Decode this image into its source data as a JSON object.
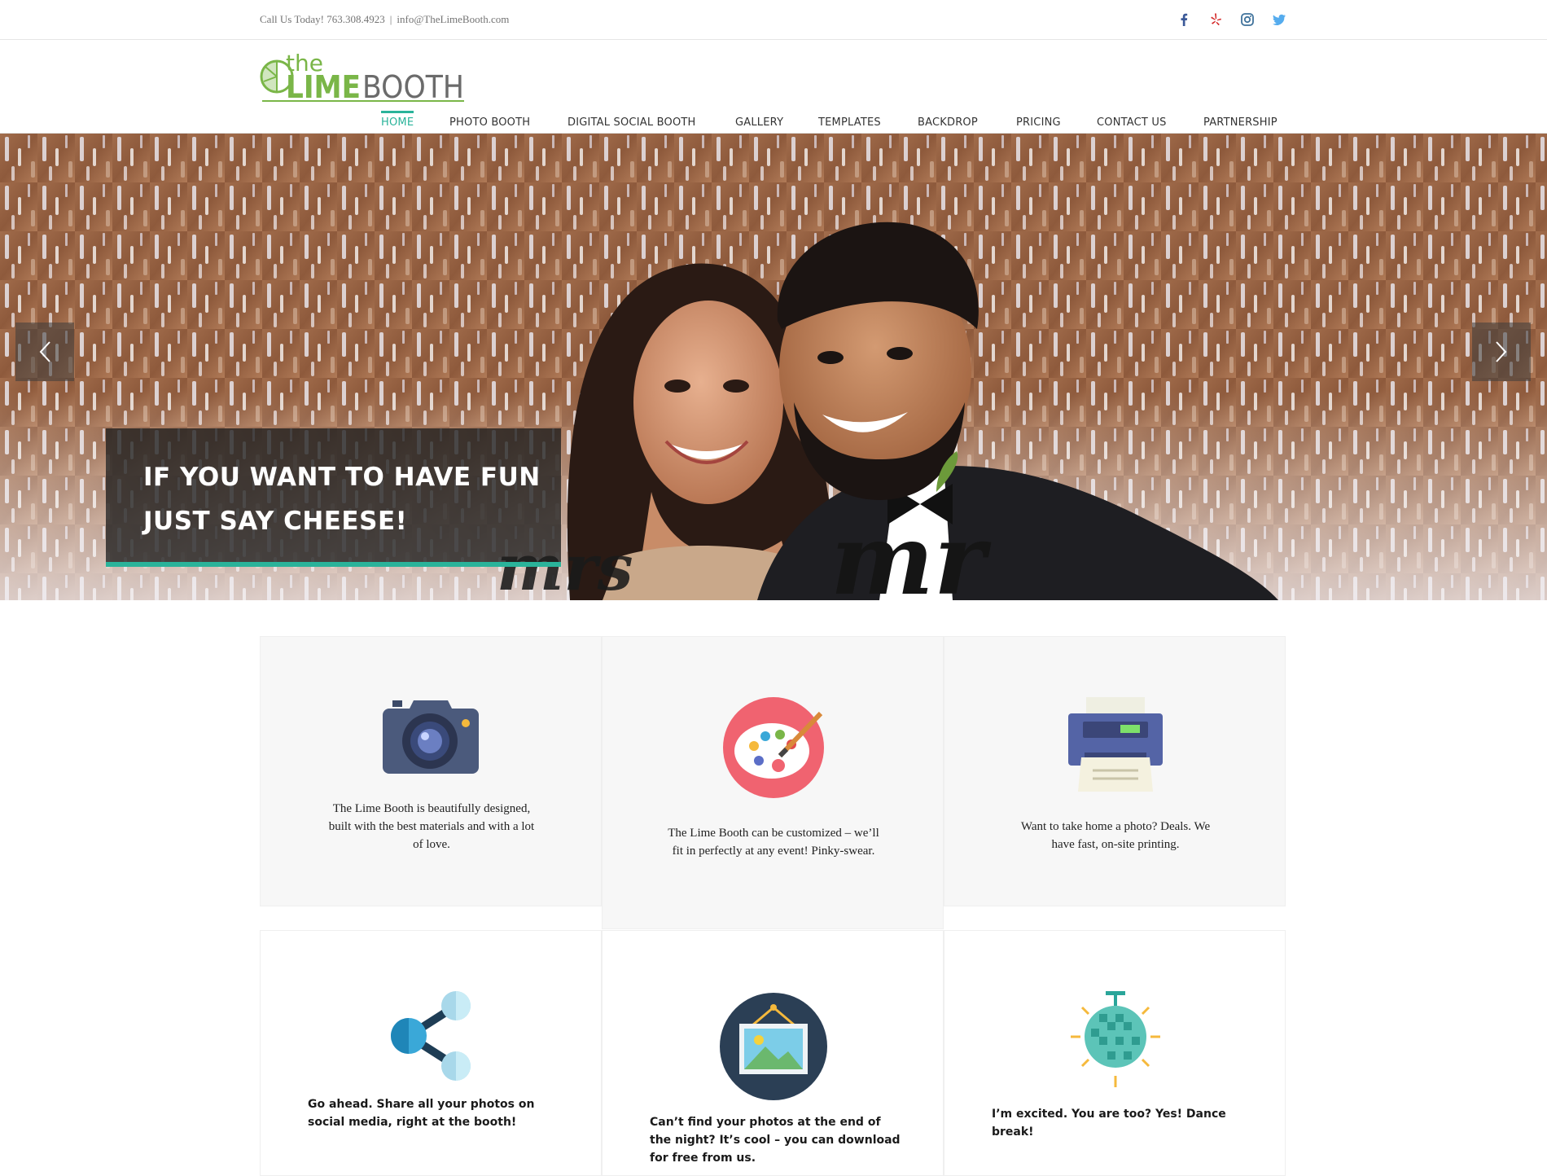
{
  "topbar": {
    "phone_text": "Call Us Today! 763.308.4923",
    "separator": "|",
    "email": "info@TheLimeBooth.com",
    "social": [
      {
        "icon": "facebook-icon",
        "color": "#3b5998"
      },
      {
        "icon": "yelp-icon",
        "color": "#d32323"
      },
      {
        "icon": "instagram-icon",
        "color": "#3f729b"
      },
      {
        "icon": "twitter-icon",
        "color": "#55acee"
      }
    ]
  },
  "logo": {
    "word_the": "the",
    "word_lime": "LIME",
    "word_booth": "BOOTH",
    "colors": {
      "green": "#7ab648",
      "gray": "#6b6b6b"
    }
  },
  "nav": {
    "items": [
      {
        "label": "HOME",
        "active": true
      },
      {
        "label": "PHOTO BOOTH",
        "active": false
      },
      {
        "label": "DIGITAL SOCIAL BOOTH",
        "active": false
      },
      {
        "label": "GALLERY",
        "active": false
      },
      {
        "label": "TEMPLATES",
        "active": false
      },
      {
        "label": "BACKDROP",
        "active": false
      },
      {
        "label": "PRICING",
        "active": false
      },
      {
        "label": "CONTACT US",
        "active": false
      },
      {
        "label": "PARTNERSHIP",
        "active": false
      }
    ],
    "accent_color": "#2ab39a"
  },
  "hero": {
    "caption_line1": "IF YOU WANT TO HAVE FUN",
    "caption_line2": "JUST SAY CHEESE!",
    "prev_icon": "chevron-left-icon",
    "next_icon": "chevron-right-icon",
    "prop_sign_left": "mrs",
    "prop_sign_right": "mr"
  },
  "features": [
    {
      "icon": "camera-icon",
      "text": "The Lime Booth is beautifully designed, built with the best materials and with a lot of love."
    },
    {
      "icon": "paint-palette-icon",
      "text": "The Lime Booth can be customized – we’ll fit in perfectly at any event! Pinky-swear."
    },
    {
      "icon": "printer-icon",
      "text": "Want to take home a photo? Deals. We have fast, on-site printing."
    },
    {
      "icon": "share-icon",
      "text": "Go ahead. Share all your photos on social media, right at the booth!"
    },
    {
      "icon": "picture-frame-icon",
      "text": "Can’t find your photos at the end of the night? It’s cool – you can download for free from us."
    },
    {
      "icon": "disco-ball-icon",
      "text": "I’m excited. You are too? Yes! Dance break!"
    }
  ]
}
